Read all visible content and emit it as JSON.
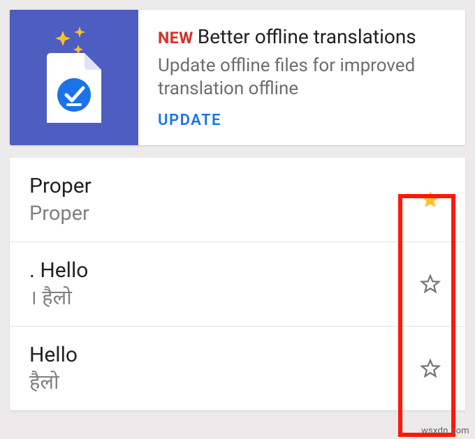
{
  "promo": {
    "new_label": "NEW",
    "title": "Better offline translations",
    "body": "Update offline files for improved translation offline",
    "action": "UPDATE"
  },
  "history": [
    {
      "source": "Proper",
      "target": "Proper",
      "starred": true
    },
    {
      "source": ". Hello",
      "target": "। हैलो",
      "starred": false
    },
    {
      "source": "Hello",
      "target": "हैलो",
      "starred": false
    }
  ],
  "colors": {
    "accent_blue": "#1a73e8",
    "promo_bg": "#4d5dc0",
    "new_red": "#d93025",
    "star_filled": "#fbc02d",
    "star_outline": "#757575",
    "highlight_border": "#ff1806"
  },
  "watermark": "wsxdn.com"
}
